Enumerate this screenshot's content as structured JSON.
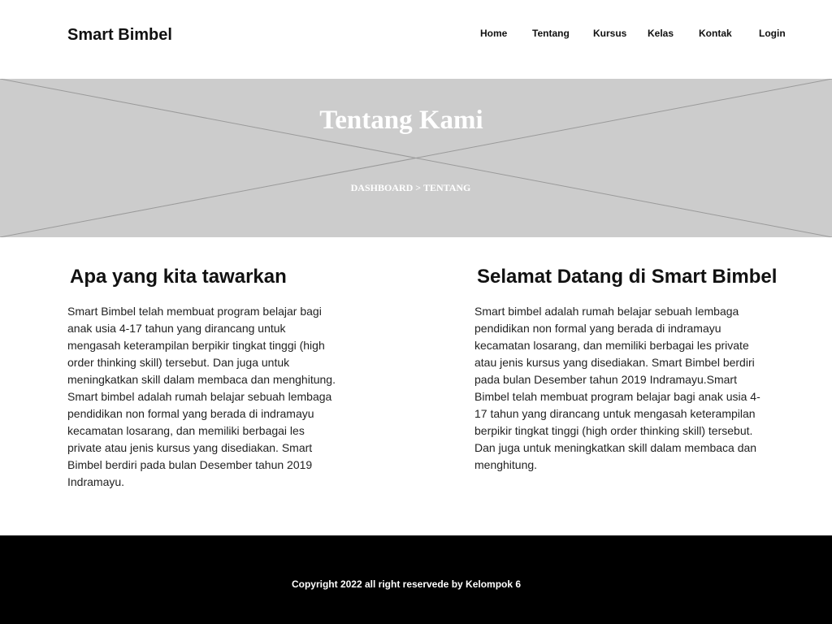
{
  "header": {
    "brand": "Smart Bimbel",
    "nav": [
      {
        "label": "Home"
      },
      {
        "label": "Tentang"
      },
      {
        "label": "Kursus"
      },
      {
        "label": "Kelas"
      },
      {
        "label": "Kontak"
      },
      {
        "label": "Login"
      }
    ]
  },
  "hero": {
    "title": "Tentang Kami",
    "breadcrumb": {
      "home": "DASHBOARD",
      "separator": ">",
      "current": "TENTANG"
    },
    "image_placeholder": "image-placeholder-icon",
    "background_color": "#cccccc"
  },
  "sections": {
    "offer": {
      "heading": "Apa yang kita tawarkan",
      "body": "Smart Bimbel telah membuat program belajar bagi anak usia 4-17 tahun yang dirancang untuk mengasah keterampilan berpikir tingkat tinggi (high order thinking skill) tersebut. Dan juga untuk meningkatkan skill dalam membaca dan menghitung. Smart bimbel adalah rumah belajar sebuah lembaga pendidikan non formal yang berada di indramayu kecamatan losarang, dan memiliki berbagai les private atau jenis kursus yang disediakan. Smart Bimbel berdiri pada bulan Desember tahun 2019 Indramayu."
    },
    "welcome": {
      "heading": "Selamat Datang di Smart Bimbel",
      "body": "Smart bimbel adalah rumah belajar sebuah lembaga pendidikan non formal yang berada di indramayu kecamatan losarang, dan memiliki berbagai les private atau jenis kursus yang disediakan. Smart Bimbel berdiri pada bulan Desember tahun 2019 Indramayu.Smart Bimbel telah membuat program belajar bagi anak usia 4-17 tahun yang dirancang untuk mengasah keterampilan berpikir tingkat tinggi (high order thinking skill) tersebut. Dan juga untuk meningkatkan skill dalam membaca dan menghitung."
    }
  },
  "footer": {
    "copyright": "Copyright 2022 all right reservede by Kelompok 6",
    "background_color": "#000000"
  }
}
